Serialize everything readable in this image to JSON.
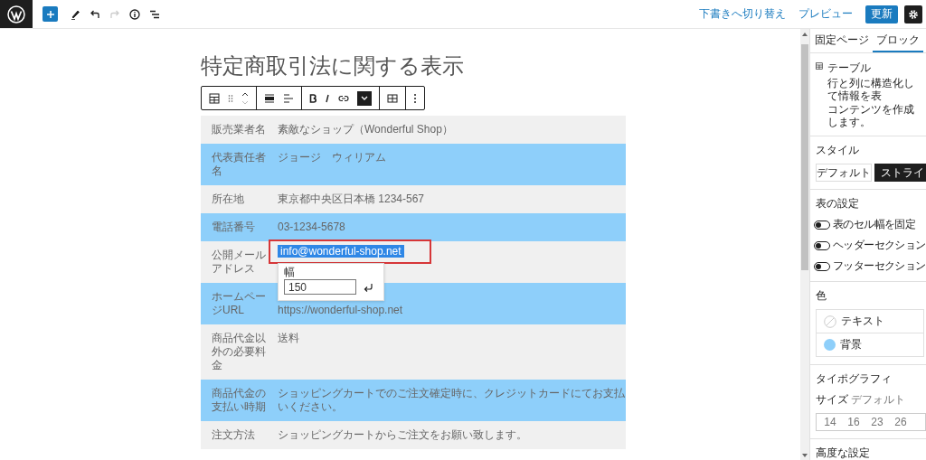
{
  "top_bar": {
    "tools": [
      {
        "kind": "add",
        "disabled": false
      },
      {
        "kind": "edit",
        "disabled": false
      },
      {
        "kind": "undo",
        "disabled": false
      },
      {
        "kind": "redo",
        "disabled": true
      },
      {
        "kind": "info",
        "disabled": false
      },
      {
        "kind": "list",
        "disabled": false
      }
    ],
    "switch_to_draft": "下書きへ切り替え",
    "preview": "プレビュー",
    "update": "更新"
  },
  "editor": {
    "title": "特定商取引法に関する表示",
    "table_rows": [
      {
        "label": "販売業者名",
        "value": "素敵なショップ（Wonderful Shop）"
      },
      {
        "label": "代表責任者名",
        "value": "ジョージ　ウィリアム"
      },
      {
        "label": "所在地",
        "value": "東京都中央区日本橋 1234-567"
      },
      {
        "label": "電話番号",
        "value": "03-1234-5678"
      },
      {
        "label": "公開メールアドレス",
        "value": "info@wonderful-shop.net",
        "kind": "selected"
      },
      {
        "label": "ホームページURL",
        "value": "https://wonderful-shop.net",
        "kind": "under_popover"
      },
      {
        "label": "商品代金以外の必要料金",
        "value": "送料"
      },
      {
        "label": "商品代金の支払い時期",
        "value": "ショッピングカートでのご注文確定時に、クレジットカードにてお支払いください。"
      },
      {
        "label": "注文方法",
        "value": "ショッピングカートからご注文をお願い致します。"
      }
    ],
    "width_popover": {
      "label": "幅",
      "value": "150"
    }
  },
  "sidebar": {
    "tabs": [
      {
        "label": "固定ページ",
        "selected": false
      },
      {
        "label": "ブロック",
        "selected": true
      }
    ],
    "block": {
      "name": "テーブル",
      "description_lines": [
        "行と列に構造化して情報を表",
        "コンテンツを作成します。"
      ]
    },
    "style_heading": "スタイル",
    "styles": [
      {
        "label": "デフォルト",
        "selected": false
      },
      {
        "label": "ストライ",
        "selected": true
      }
    ],
    "table_settings_heading": "表の設定",
    "toggles": [
      {
        "label": "表のセル幅を固定",
        "on": false
      },
      {
        "label": "ヘッダーセクション",
        "on": false
      },
      {
        "label": "フッターセクション",
        "on": false
      }
    ],
    "color_heading": "色",
    "colors": [
      {
        "label": "テキスト"
      },
      {
        "label": "背景",
        "color": "#8ecffa"
      }
    ],
    "typography_heading": "タイポグラフィ",
    "size_label": "サイズ",
    "size_value": "デフォルト",
    "sizes": [
      "14",
      "16",
      "23",
      "26"
    ],
    "advanced": "高度な設定"
  }
}
